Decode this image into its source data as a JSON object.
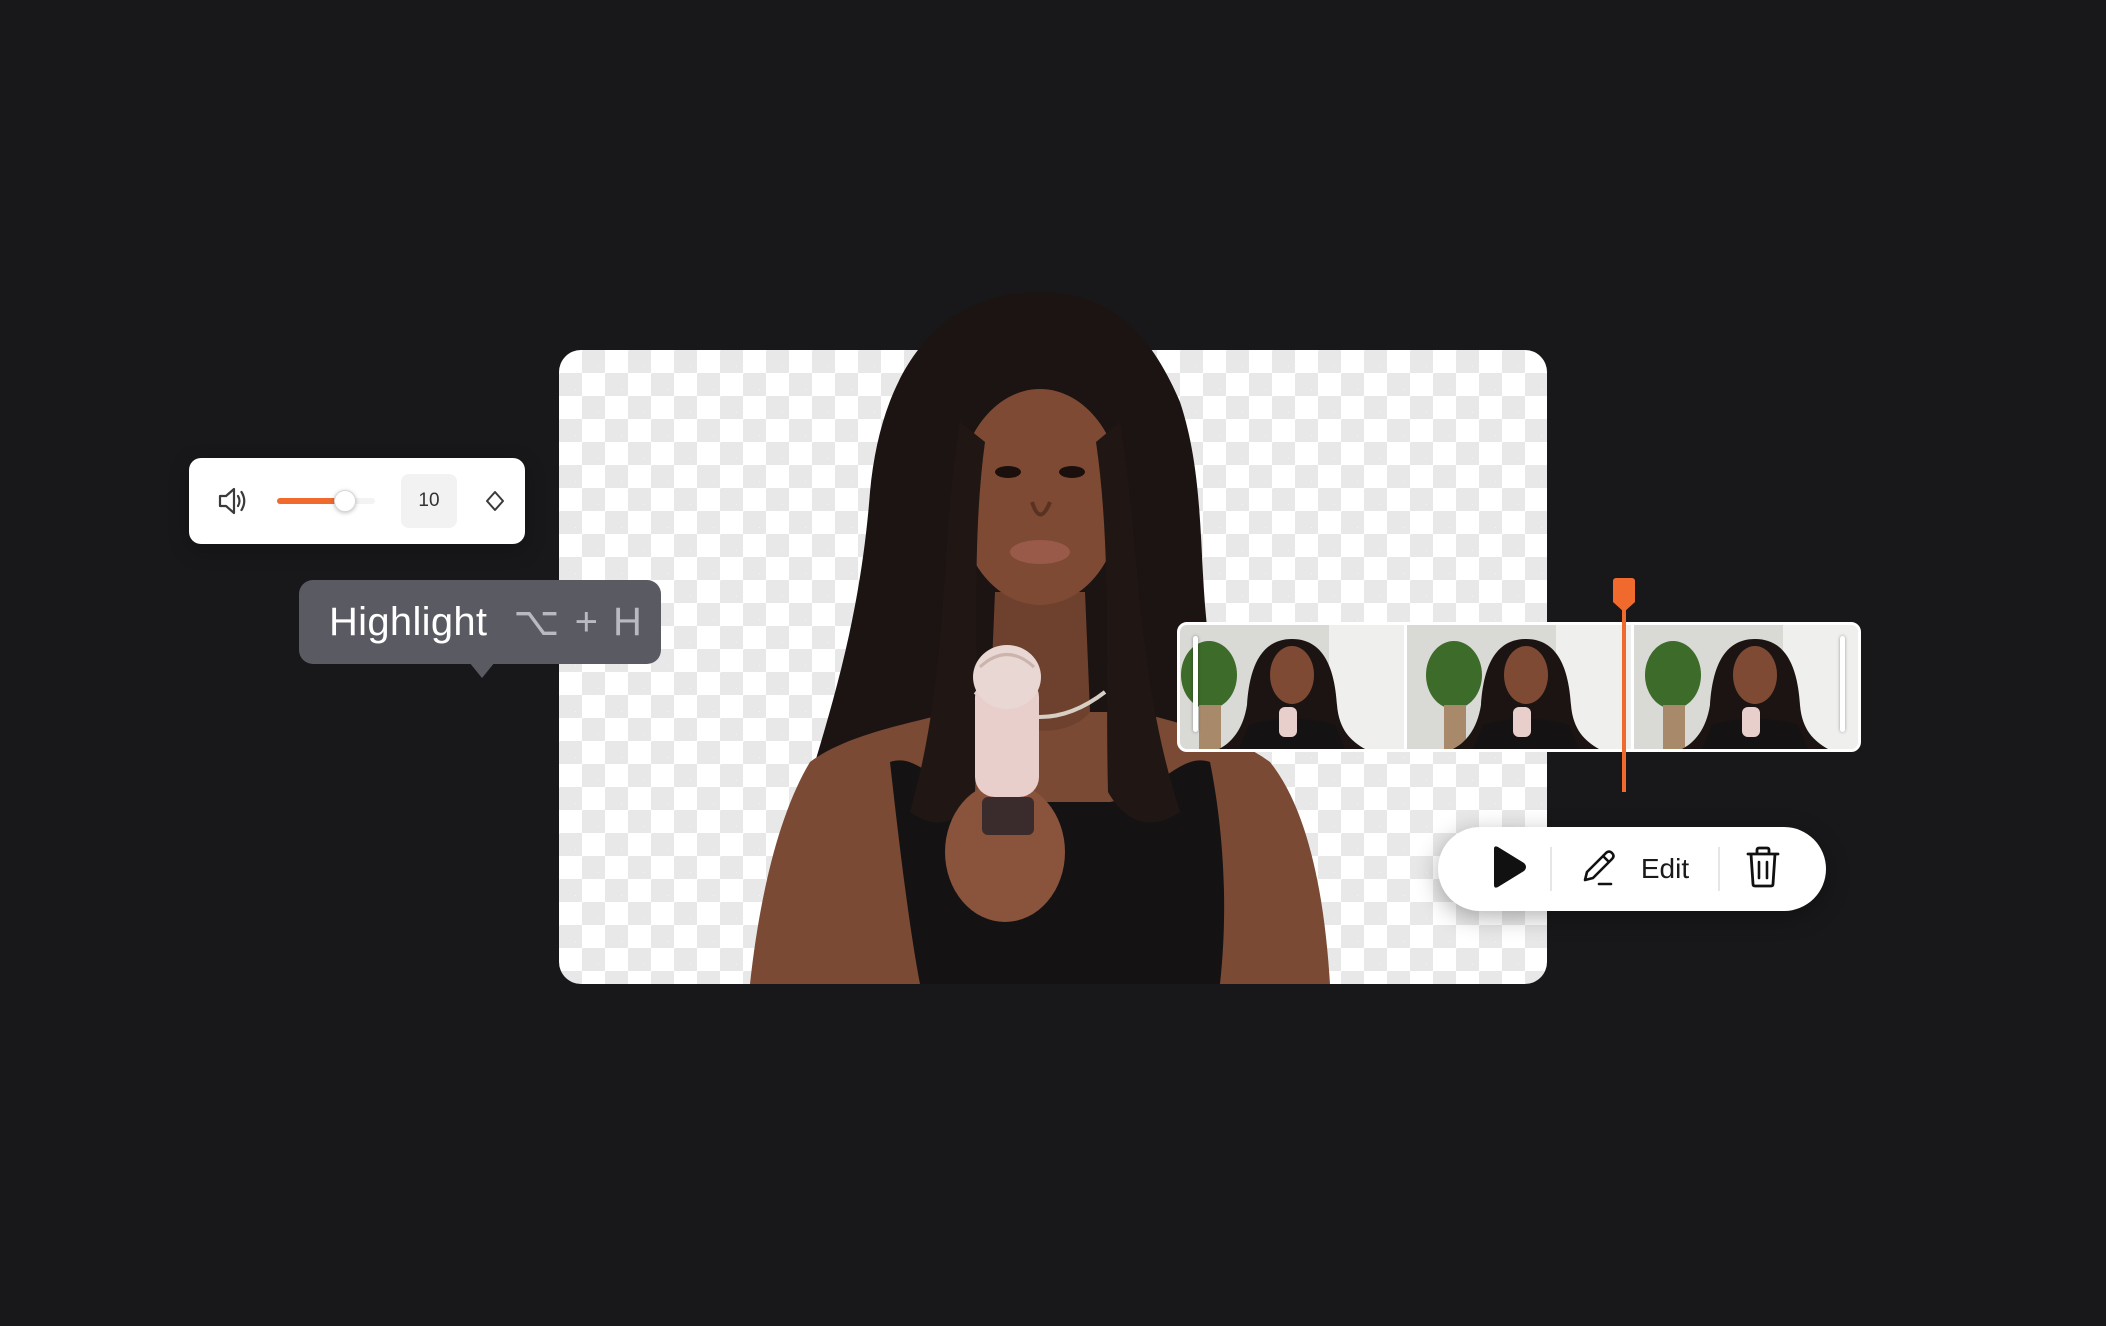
{
  "volume": {
    "value": "10",
    "level_fraction": 0.68,
    "icon": "speaker-icon",
    "keyframe_icon": "diamond-keyframe-icon"
  },
  "tooltip": {
    "label": "Highlight",
    "shortcut": "⌥ + H"
  },
  "timeline": {
    "frames": 3,
    "playhead_fraction": 0.653
  },
  "toolbar": {
    "play_icon": "play-icon",
    "edit_icon": "pencil-icon",
    "edit_label": "Edit",
    "delete_icon": "trash-icon"
  },
  "colors": {
    "background": "#18181a",
    "accent": "#f06a2e",
    "tooltip": "#5a5a63"
  }
}
